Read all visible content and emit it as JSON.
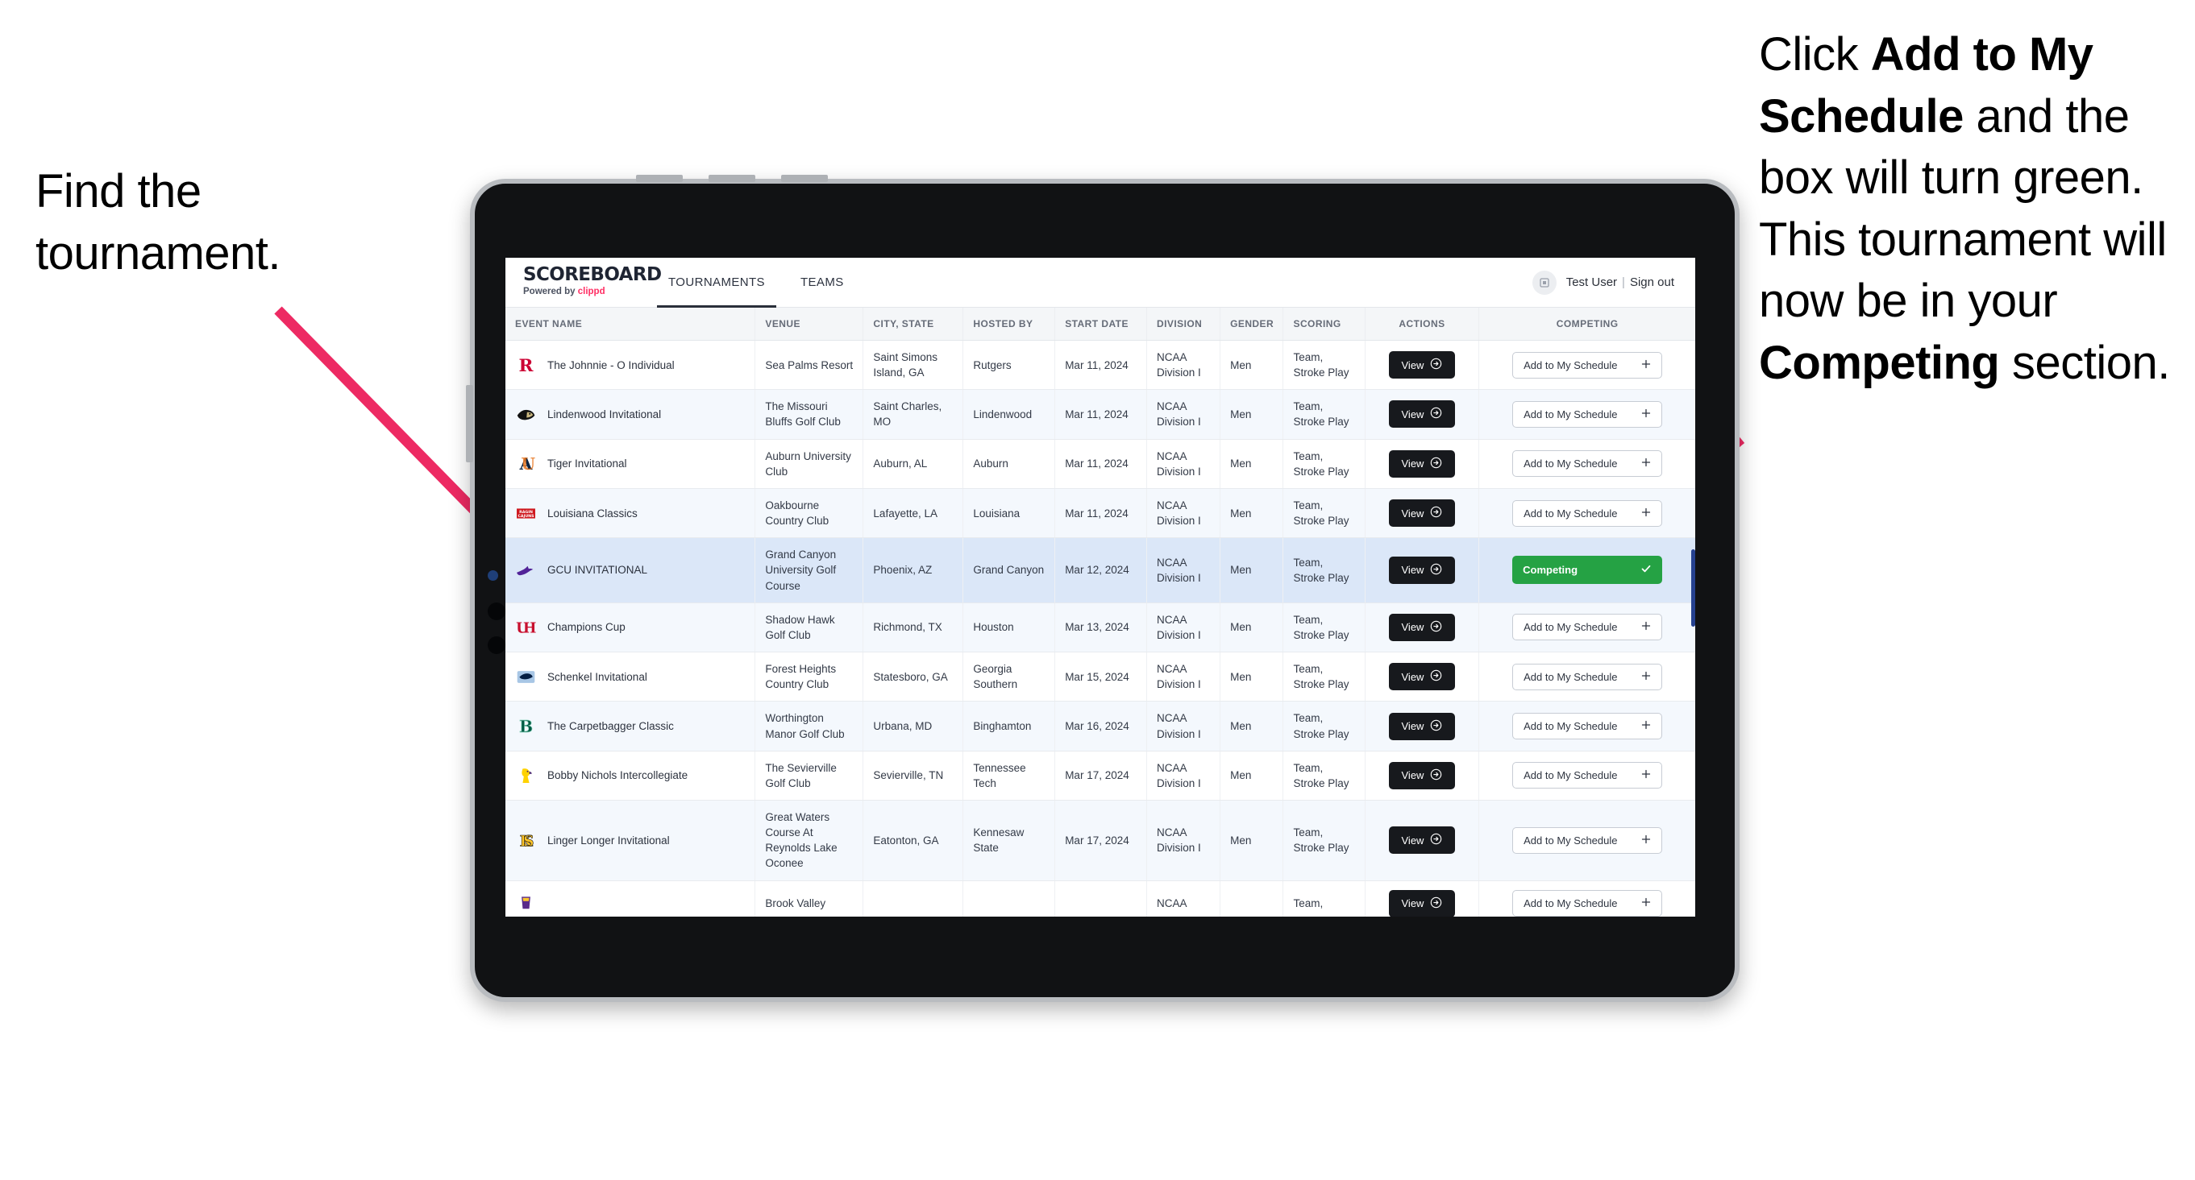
{
  "annotations": {
    "left": {
      "line1": "Find the",
      "line2": "tournament."
    },
    "right": {
      "p1_a": "Click ",
      "p1_b": "Add to My Schedule",
      "p1_c": " and the box will turn green. This tournament will now be in your ",
      "p1_d": "Competing",
      "p1_e": " section."
    },
    "arrow_color": "#ED2A63"
  },
  "app": {
    "brand": {
      "title": "SCOREBOARD",
      "powered_prefix": "Powered by ",
      "powered_name": "clippd"
    },
    "nav": [
      {
        "label": "TOURNAMENTS",
        "active": true
      },
      {
        "label": "TEAMS",
        "active": false
      }
    ],
    "user": {
      "avatar_icon": "user-avatar-icon",
      "name": "Test User",
      "separator": "|",
      "signout": "Sign out"
    }
  },
  "table": {
    "columns": [
      "EVENT NAME",
      "VENUE",
      "CITY, STATE",
      "HOSTED BY",
      "START DATE",
      "DIVISION",
      "GENDER",
      "SCORING",
      "ACTIONS",
      "COMPETING"
    ],
    "view_label": "View",
    "view_icon": "arrow-circle-right-icon",
    "add_label": "Add to My Schedule",
    "add_icon": "plus-icon",
    "competing_label": "Competing",
    "competing_icon": "check-icon",
    "competing_color": "#25A244",
    "rows": [
      {
        "logo": "rutgers-logo",
        "event": "The Johnnie - O Individual",
        "venue": "Sea Palms Resort",
        "city": "Saint Simons Island, GA",
        "host": "Rutgers",
        "date": "Mar 11, 2024",
        "division": "NCAA Division I",
        "gender": "Men",
        "scoring": "Team, Stroke Play",
        "competing": false
      },
      {
        "logo": "lindenwood-logo",
        "event": "Lindenwood Invitational",
        "venue": "The Missouri Bluffs Golf Club",
        "city": "Saint Charles, MO",
        "host": "Lindenwood",
        "date": "Mar 11, 2024",
        "division": "NCAA Division I",
        "gender": "Men",
        "scoring": "Team, Stroke Play",
        "competing": false
      },
      {
        "logo": "auburn-logo",
        "event": "Tiger Invitational",
        "venue": "Auburn University Club",
        "city": "Auburn, AL",
        "host": "Auburn",
        "date": "Mar 11, 2024",
        "division": "NCAA Division I",
        "gender": "Men",
        "scoring": "Team, Stroke Play",
        "competing": false
      },
      {
        "logo": "louisiana-logo",
        "event": "Louisiana Classics",
        "venue": "Oakbourne Country Club",
        "city": "Lafayette, LA",
        "host": "Louisiana",
        "date": "Mar 11, 2024",
        "division": "NCAA Division I",
        "gender": "Men",
        "scoring": "Team, Stroke Play",
        "competing": false
      },
      {
        "logo": "gcu-logo",
        "event": "GCU INVITATIONAL",
        "venue": "Grand Canyon University Golf Course",
        "city": "Phoenix, AZ",
        "host": "Grand Canyon",
        "date": "Mar 12, 2024",
        "division": "NCAA Division I",
        "gender": "Men",
        "scoring": "Team, Stroke Play",
        "competing": true
      },
      {
        "logo": "houston-logo",
        "event": "Champions Cup",
        "venue": "Shadow Hawk Golf Club",
        "city": "Richmond, TX",
        "host": "Houston",
        "date": "Mar 13, 2024",
        "division": "NCAA Division I",
        "gender": "Men",
        "scoring": "Team, Stroke Play",
        "competing": false
      },
      {
        "logo": "georgia-southern-logo",
        "event": "Schenkel Invitational",
        "venue": "Forest Heights Country Club",
        "city": "Statesboro, GA",
        "host": "Georgia Southern",
        "date": "Mar 15, 2024",
        "division": "NCAA Division I",
        "gender": "Men",
        "scoring": "Team, Stroke Play",
        "competing": false
      },
      {
        "logo": "binghamton-logo",
        "event": "The Carpetbagger Classic",
        "venue": "Worthington Manor Golf Club",
        "city": "Urbana, MD",
        "host": "Binghamton",
        "date": "Mar 16, 2024",
        "division": "NCAA Division I",
        "gender": "Men",
        "scoring": "Team, Stroke Play",
        "competing": false
      },
      {
        "logo": "tennessee-tech-logo",
        "event": "Bobby Nichols Intercollegiate",
        "venue": "The Sevierville Golf Club",
        "city": "Sevierville, TN",
        "host": "Tennessee Tech",
        "date": "Mar 17, 2024",
        "division": "NCAA Division I",
        "gender": "Men",
        "scoring": "Team, Stroke Play",
        "competing": false
      },
      {
        "logo": "kennesaw-state-logo",
        "event": "Linger Longer Invitational",
        "venue": "Great Waters Course At Reynolds Lake Oconee",
        "city": "Eatonton, GA",
        "host": "Kennesaw State",
        "date": "Mar 17, 2024",
        "division": "NCAA Division I",
        "gender": "Men",
        "scoring": "Team, Stroke Play",
        "competing": false
      },
      {
        "logo": "ecu-logo",
        "event": "",
        "venue": "Brook Valley",
        "city": "",
        "host": "",
        "date": "",
        "division": "NCAA",
        "gender": "",
        "scoring": "Team,",
        "competing": false
      }
    ]
  }
}
